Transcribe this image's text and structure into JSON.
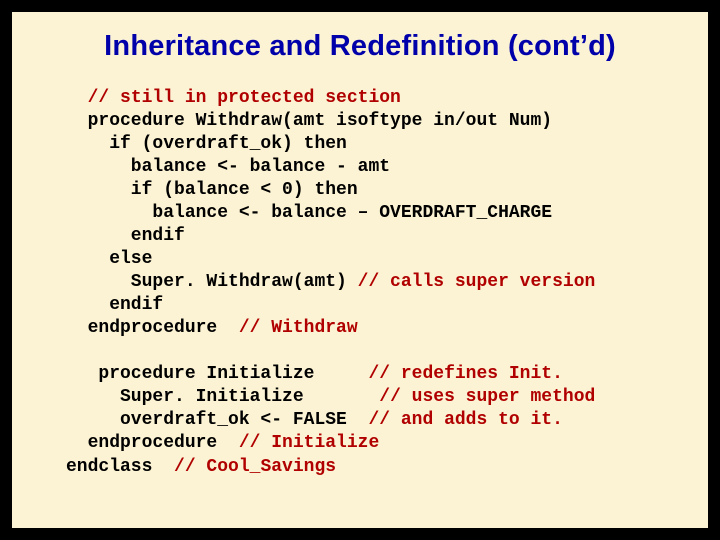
{
  "title": "Inheritance and Redefinition (cont’d)",
  "code": {
    "lines": [
      {
        "indent": 2,
        "segments": [
          {
            "t": "// still in protected section",
            "c": true
          }
        ]
      },
      {
        "indent": 2,
        "segments": [
          {
            "t": "procedure Withdraw(amt isoftype in/out Num)"
          }
        ]
      },
      {
        "indent": 4,
        "segments": [
          {
            "t": "if (overdraft_ok) then"
          }
        ]
      },
      {
        "indent": 6,
        "segments": [
          {
            "t": "balance <- balance - amt"
          }
        ]
      },
      {
        "indent": 6,
        "segments": [
          {
            "t": "if (balance < 0) then"
          }
        ]
      },
      {
        "indent": 8,
        "segments": [
          {
            "t": "balance <- balance – OVERDRAFT_CHARGE"
          }
        ]
      },
      {
        "indent": 6,
        "segments": [
          {
            "t": "endif"
          }
        ]
      },
      {
        "indent": 4,
        "segments": [
          {
            "t": "else"
          }
        ]
      },
      {
        "indent": 6,
        "segments": [
          {
            "t": "Super. Withdraw(amt) "
          },
          {
            "t": "// calls super version",
            "c": true
          }
        ]
      },
      {
        "indent": 4,
        "segments": [
          {
            "t": "endif"
          }
        ]
      },
      {
        "indent": 2,
        "segments": [
          {
            "t": "endprocedure  "
          },
          {
            "t": "// Withdraw",
            "c": true
          }
        ]
      },
      {
        "indent": 0,
        "segments": [
          {
            "t": " "
          }
        ]
      },
      {
        "indent": 3,
        "segments": [
          {
            "t": "procedure Initialize     "
          },
          {
            "t": "// redefines Init.",
            "c": true
          }
        ]
      },
      {
        "indent": 5,
        "segments": [
          {
            "t": "Super. Initialize       "
          },
          {
            "t": "// uses super method",
            "c": true
          }
        ]
      },
      {
        "indent": 5,
        "segments": [
          {
            "t": "overdraft_ok <- FALSE  "
          },
          {
            "t": "// and adds to it.",
            "c": true
          }
        ]
      },
      {
        "indent": 2,
        "segments": [
          {
            "t": "endprocedure  "
          },
          {
            "t": "// Initialize",
            "c": true
          }
        ]
      },
      {
        "indent": 0,
        "segments": [
          {
            "t": "endclass  "
          },
          {
            "t": "// Cool_Savings",
            "c": true
          }
        ]
      }
    ]
  }
}
